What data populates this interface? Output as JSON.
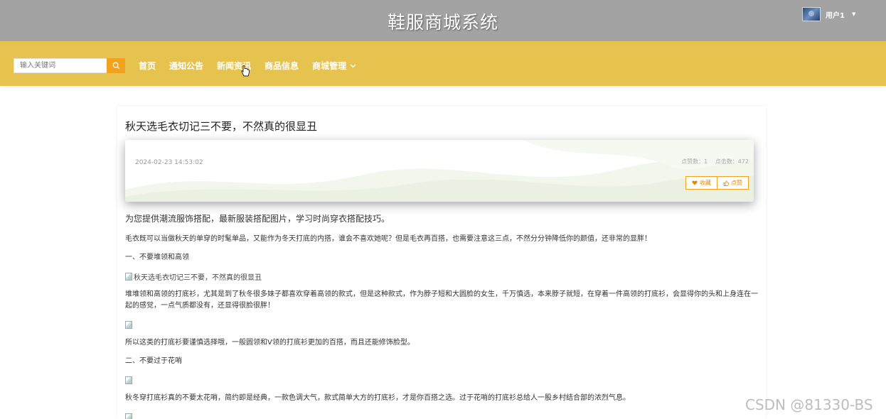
{
  "header": {
    "site_title": "鞋服商城系统",
    "user_name": "用户1"
  },
  "nav": {
    "search_placeholder": "输入关键词",
    "items": [
      "首页",
      "通知公告",
      "新闻资讯",
      "商品信息",
      "商城管理"
    ]
  },
  "article": {
    "title": "秋天选毛衣切记三不要，不然真的很显丑",
    "date": "2024-02-23 14:53:02",
    "likes_label": "点赞数：1",
    "clicks_label": "点击数：472",
    "favorite_label": "收藏",
    "like_label": "点赞",
    "intro": "为您提供潮流服饰搭配，最新服装搭配图片，学习时尚穿衣搭配技巧。",
    "p1": "毛衣既可以当做秋天的单穿的时髦单品，又能作为冬天打底的内搭，谁会不喜欢她呢？但是毛衣再百搭，也需要注意这三点，不然分分钟降低你的颜值，还非常的显胖！",
    "h1": "一、不要堆领和高领",
    "img_alt": "秋天选毛衣切记三不要，不然真的很显丑",
    "p2": "堆堆领和高领的打底衫，尤其是到了秋冬很多妹子都喜欢穿着高领的款式，但是这种款式，作为脖子短和大圆脸的女生，千万慎选，本来脖子就短，在穿着一件高领的打底衫，会显得你的头和上身连在一起的感觉，一点气质都没有，还显得很脸很胖！",
    "p3": "所以这类的打底衫要谨慎选择哦，一般圆领和V领的打底衫更加的百搭，而且还能修饰脸型。",
    "h2": "二、不要过于花哨",
    "p4": "秋冬穿打底衫真的不要太花哨，简约即是经典，一款色调大气，款式简单大方的打底衫，才是你百搭之选。过于花哨的打底衫总给人一股乡村结合部的浓烈气息。"
  },
  "watermark": "CSDN @81330-BS",
  "colors": {
    "topbar": "#a3a3a3",
    "navbar": "#e6c34f",
    "accent": "#f2a31d"
  }
}
